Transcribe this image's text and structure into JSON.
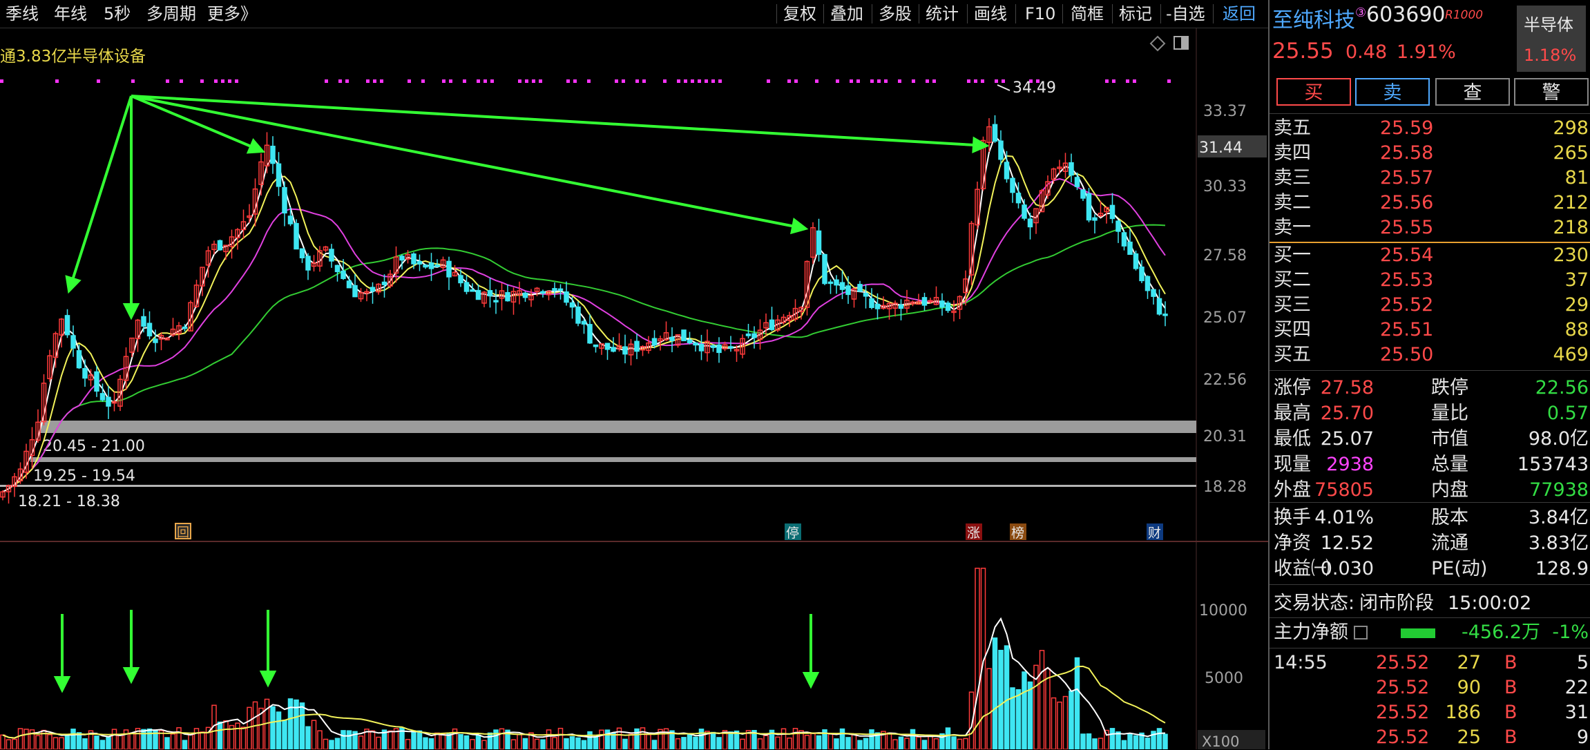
{
  "toolbar": {
    "left": [
      "季线",
      "年线",
      "5秒",
      "多周期",
      "更多》"
    ],
    "right": [
      "复权",
      "叠加",
      "多股",
      "统计",
      "画线",
      "F10",
      "简框",
      "标记",
      "-自选",
      "返回"
    ]
  },
  "chart": {
    "float_cap": "通3.83亿",
    "sector": "半导体设备",
    "price_axis": [
      "33.37",
      "30.33",
      "27.58",
      "25.07",
      "22.56",
      "20.31",
      "18.28"
    ],
    "current_tag": "31.44",
    "high_label": "34.49",
    "zone_labels": [
      "20.45 - 21.00",
      "19.25 - 19.54",
      "18.21 - 18.38"
    ],
    "markers": [
      "回",
      "停",
      "涨",
      "榜",
      "财"
    ],
    "vol_axis": [
      "10000",
      "5000"
    ],
    "vol_unit": "X100",
    "colors": {
      "up": "#ff3b3b",
      "down": "#3ee6f2",
      "ma5": "#ffffff",
      "ma10": "#f2f25a",
      "ma20": "#e040e0",
      "ma60": "#33cc33",
      "arrow": "#33ff33"
    }
  },
  "quote": {
    "name": "至纯科技",
    "badge_num": "③",
    "code": "603690",
    "badge": "R1000",
    "price": "25.55",
    "change": "0.48",
    "change_pct": "1.91%",
    "sector_name": "半导体",
    "sector_pct": "1.18%",
    "buttons": [
      "买",
      "卖",
      "查",
      "警"
    ]
  },
  "asks": [
    {
      "label": "卖五",
      "price": "25.59",
      "vol": "298"
    },
    {
      "label": "卖四",
      "price": "25.58",
      "vol": "265"
    },
    {
      "label": "卖三",
      "price": "25.57",
      "vol": "81"
    },
    {
      "label": "卖二",
      "price": "25.56",
      "vol": "212"
    },
    {
      "label": "卖一",
      "price": "25.55",
      "vol": "218"
    }
  ],
  "bids": [
    {
      "label": "买一",
      "price": "25.54",
      "vol": "230"
    },
    {
      "label": "买二",
      "price": "25.53",
      "vol": "37"
    },
    {
      "label": "买三",
      "price": "25.52",
      "vol": "29"
    },
    {
      "label": "买四",
      "price": "25.51",
      "vol": "88"
    },
    {
      "label": "买五",
      "price": "25.50",
      "vol": "469"
    }
  ],
  "stats": [
    {
      "l1": "涨停",
      "v1": "27.58",
      "c1": "r",
      "l2": "跌停",
      "v2": "22.56",
      "c2": "g"
    },
    {
      "l1": "最高",
      "v1": "25.70",
      "c1": "r",
      "l2": "量比",
      "v2": "0.57",
      "c2": "g"
    },
    {
      "l1": "最低",
      "v1": "25.07",
      "c1": "w",
      "l2": "市值",
      "v2": "98.0亿",
      "c2": "w"
    },
    {
      "l1": "现量",
      "v1": "2938",
      "c1": "m",
      "l2": "总量",
      "v2": "153743",
      "c2": "w"
    },
    {
      "l1": "外盘",
      "v1": "75805",
      "c1": "r",
      "l2": "内盘",
      "v2": "77938",
      "c2": "g"
    }
  ],
  "stats2": [
    {
      "l1": "换手",
      "v1": "4.01%",
      "l2": "股本",
      "v2": "3.84亿"
    },
    {
      "l1": "净资",
      "v1": "12.52",
      "l2": "流通",
      "v2": "3.83亿"
    },
    {
      "l1": "收益㈠",
      "v1": "0.030",
      "l2": "PE(动)",
      "v2": "128.9"
    }
  ],
  "status": {
    "label": "交易状态:",
    "value": "闭市阶段",
    "time": "15:00:02"
  },
  "flow": {
    "label": "主力净额",
    "value": "-456.2万",
    "pct": "-1%"
  },
  "ticks": [
    {
      "time": "14:55",
      "price": "25.52",
      "vol": "27",
      "side": "B",
      "n": "5"
    },
    {
      "time": "",
      "price": "25.52",
      "vol": "90",
      "side": "B",
      "n": "22"
    },
    {
      "time": "",
      "price": "25.52",
      "vol": "186",
      "side": "B",
      "n": "31"
    },
    {
      "time": "",
      "price": "25.52",
      "vol": "25",
      "side": "B",
      "n": "9"
    }
  ]
}
